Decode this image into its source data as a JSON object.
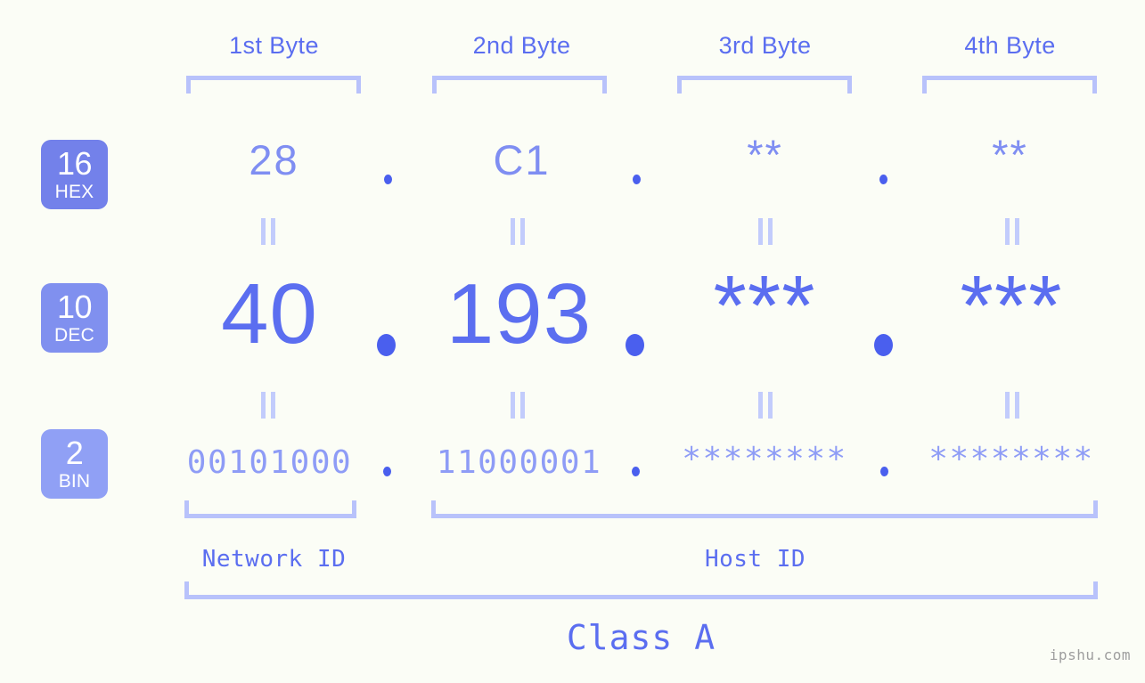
{
  "meta": {
    "watermark": "ipshu.com",
    "colors": {
      "background": "#fbfdf6",
      "accent": "#5b6ef0",
      "accent_light": "#8e9cf6",
      "bracket": "#b8c2fb",
      "badge_hex": "#7381ea",
      "badge_dec": "#8090ef",
      "badge_bin": "#90a0f5",
      "dot": "#4a5fee",
      "watermark": "#9e9e9e"
    }
  },
  "byte_headers": [
    {
      "label": "1st Byte"
    },
    {
      "label": "2nd Byte"
    },
    {
      "label": "3rd Byte"
    },
    {
      "label": "4th Byte"
    }
  ],
  "rows": [
    {
      "key": "hex",
      "badge_number": "16",
      "badge_system": "HEX",
      "values": [
        "28",
        "C1",
        "**",
        "**"
      ],
      "separators": [
        ".",
        ".",
        "."
      ]
    },
    {
      "key": "dec",
      "badge_number": "10",
      "badge_system": "DEC",
      "values": [
        "40",
        "193",
        "***",
        "***"
      ],
      "separators": [
        ".",
        ".",
        "."
      ]
    },
    {
      "key": "bin",
      "badge_number": "2",
      "badge_system": "BIN",
      "values": [
        "00101000",
        "11000001",
        "********",
        "********"
      ],
      "separators": [
        ".",
        ".",
        "."
      ]
    }
  ],
  "id_sections": [
    {
      "label": "Network ID"
    },
    {
      "label": "Host ID"
    }
  ],
  "class_label": "Class A"
}
